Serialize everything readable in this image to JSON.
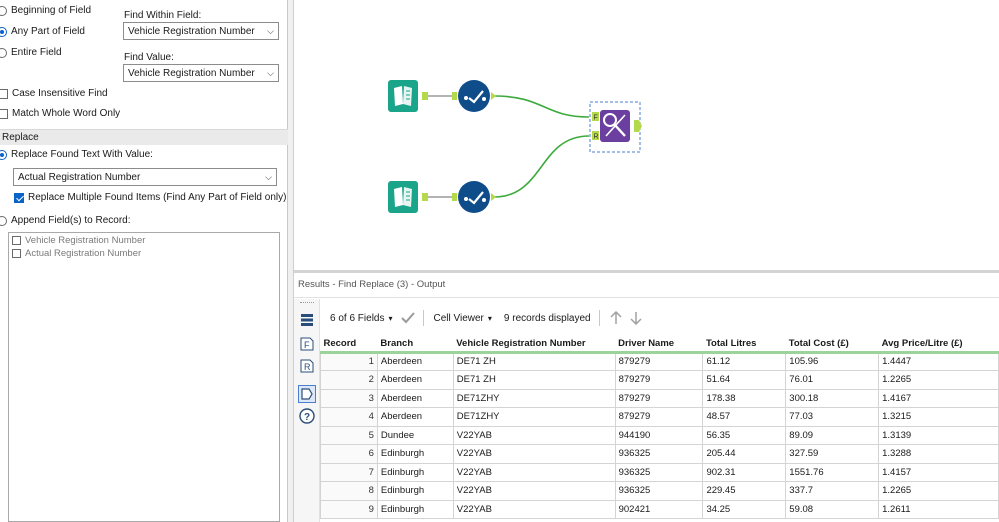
{
  "config": {
    "find_position": [
      {
        "label": "Beginning of Field",
        "selected": false
      },
      {
        "label": "Any Part of Field",
        "selected": true
      },
      {
        "label": "Entire Field",
        "selected": false
      }
    ],
    "find_within_label": "Find Within Field:",
    "find_within_value": "Vehicle Registration Number",
    "find_value_label": "Find Value:",
    "find_value_value": "Vehicle Registration Number",
    "case_insensitive_label": "Case Insensitive Find",
    "match_whole_word_label": "Match Whole Word Only",
    "replace_section": "Replace",
    "replace_found_label": "Replace Found Text With Value:",
    "replace_value": "Actual Registration Number",
    "replace_multiple_label": "Replace Multiple Found Items (Find Any Part of Field only)",
    "append_label": "Append Field(s) to Record:",
    "append_fields": [
      "Vehicle Registration Number",
      "Actual Registration Number"
    ]
  },
  "canvas": {
    "anchor_f": "F",
    "anchor_r": "R",
    "colors": {
      "input": "#1aa58b",
      "select": "#0f4c8a",
      "find_replace": "#6b3fa0",
      "connector": "#3caa3c"
    }
  },
  "results": {
    "title": "Results - Find Replace (3) - Output",
    "fields_label": "6 of 6 Fields",
    "viewer_label": "Cell Viewer",
    "records_label": "9 records displayed",
    "side_f": "F",
    "side_r": "R",
    "columns": [
      "Record",
      "Branch",
      "Vehicle Registration Number",
      "Driver Name",
      "Total Litres",
      "Total Cost (£)",
      "Avg Price/Litre (£)"
    ],
    "rows": [
      [
        "1",
        "Aberdeen",
        "DE71 ZH",
        "879279",
        "61.12",
        "105.96",
        "1.4447"
      ],
      [
        "2",
        "Aberdeen",
        "DE71 ZH",
        "879279",
        "51.64",
        "76.01",
        "1.2265"
      ],
      [
        "3",
        "Aberdeen",
        "DE71ZHY",
        "879279",
        "178.38",
        "300.18",
        "1.4167"
      ],
      [
        "4",
        "Aberdeen",
        "DE71ZHY",
        "879279",
        "48.57",
        "77.03",
        "1.3215"
      ],
      [
        "5",
        "Dundee",
        "V22YAB",
        "944190",
        "56.35",
        "89.09",
        "1.3139"
      ],
      [
        "6",
        "Edinburgh",
        "V22YAB",
        "936325",
        "205.44",
        "327.59",
        "1.3288"
      ],
      [
        "7",
        "Edinburgh",
        "V22YAB",
        "936325",
        "902.31",
        "1551.76",
        "1.4157"
      ],
      [
        "8",
        "Edinburgh",
        "V22YAB",
        "936325",
        "229.45",
        "337.7",
        "1.2265"
      ],
      [
        "9",
        "Edinburgh",
        "V22YAB",
        "902421",
        "34.25",
        "59.08",
        "1.2611"
      ]
    ]
  }
}
